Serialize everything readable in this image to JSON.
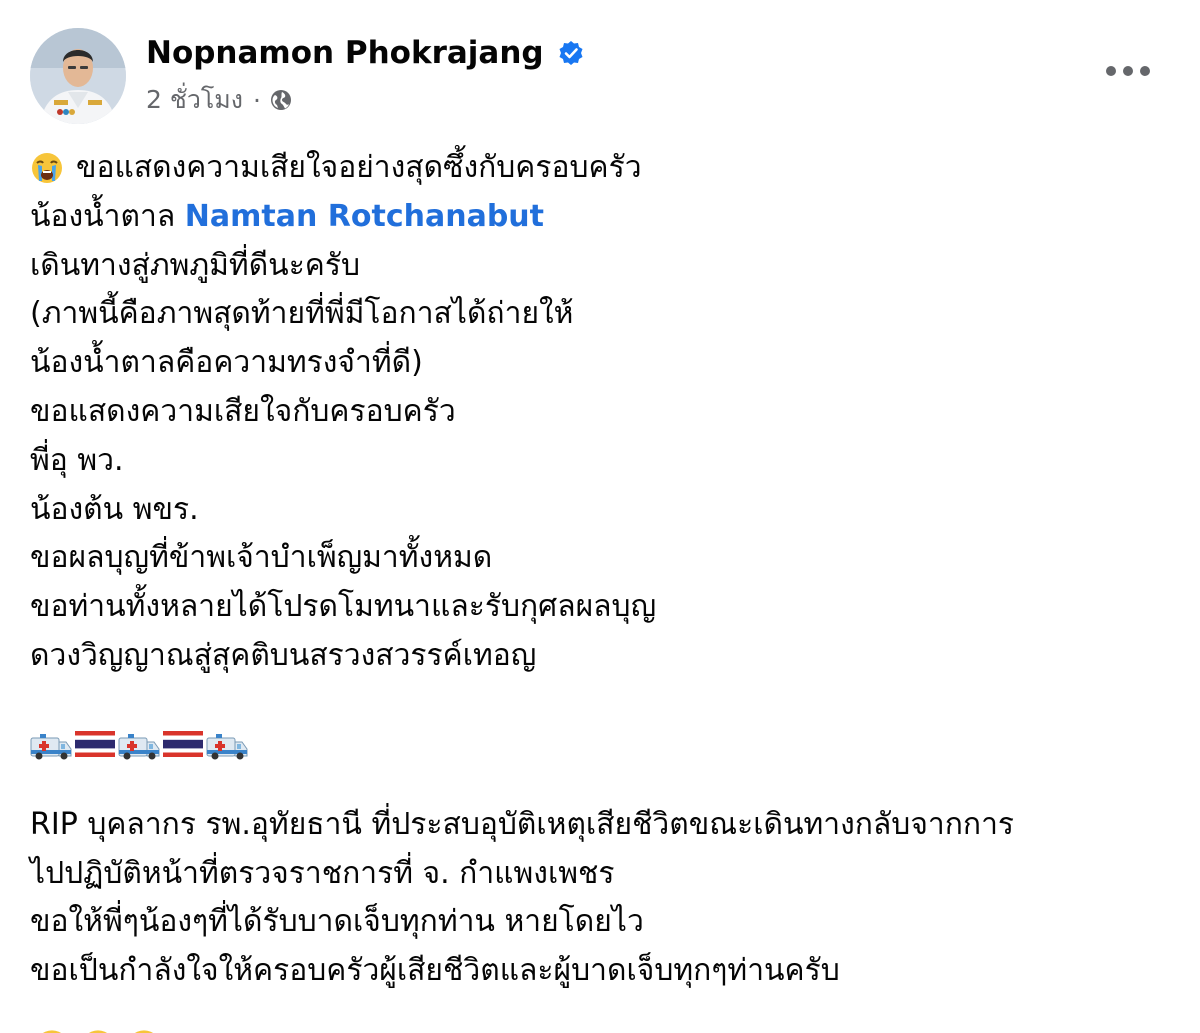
{
  "post": {
    "author": {
      "name": "Nopnamon Phokrajang",
      "verified": true
    },
    "time": "2 ชั่วโมง",
    "separator": "·",
    "privacy_icon": "globe-icon",
    "more_icon": "more-options-icon",
    "paragraph1": {
      "line1_text": "ขอแสดงความเสียใจอย่างสุดซึ้งกับครอบครัว",
      "line2_prefix": "น้องน้ำตาล ",
      "line2_mention": "Namtan Rotchanabut",
      "lines": [
        "เดินทางสู่ภพภูมิที่ดีนะครับ",
        "(ภาพนี้คือภาพสุดท้ายที่พี่มีโอกาสได้ถ่ายให้",
        "น้องน้ำตาลคือความทรงจำที่ดี)",
        "ขอแสดงความเสียใจกับครอบครัว",
        "พี่อุ พว.",
        "น้องต้น พขร.",
        "ขอผลบุญที่ข้าพเจ้าบำเพ็ญมาทั้งหมด",
        "ขอท่านทั้งหลายได้โปรดโมทนาและรับกุศลผลบุญ",
        "ดวงวิญญาณสู่สุคติบนสรวงสวรรค์เทอญ"
      ]
    },
    "emoji_row": [
      "ambulance",
      "thai-flag",
      "ambulance",
      "thai-flag",
      "ambulance"
    ],
    "paragraph2": [
      "RIP บุคลากร รพ.อุทัยธานี ที่ประสบอุบัติเหตุเสียชีวิตขณะเดินทางกลับจากการ",
      "ไปปฏิบัติหน้าที่ตรวจราชการที่ จ. กำแพงเพชร",
      "ขอให้พี่ๆน้องๆที่ได้รับบาดเจ็บทุกท่าน หายโดยไว",
      "ขอเป็นกำลังใจให้ครอบครัวผู้เสียชีวิตและผู้บาดเจ็บทุกๆท่านครับ"
    ],
    "closing_emojis": [
      "crying-face",
      "crying-face",
      "crying-face"
    ],
    "colors": {
      "mention": "#216fdb",
      "verified": "#1877f2",
      "secondary_text": "#65676b"
    }
  }
}
